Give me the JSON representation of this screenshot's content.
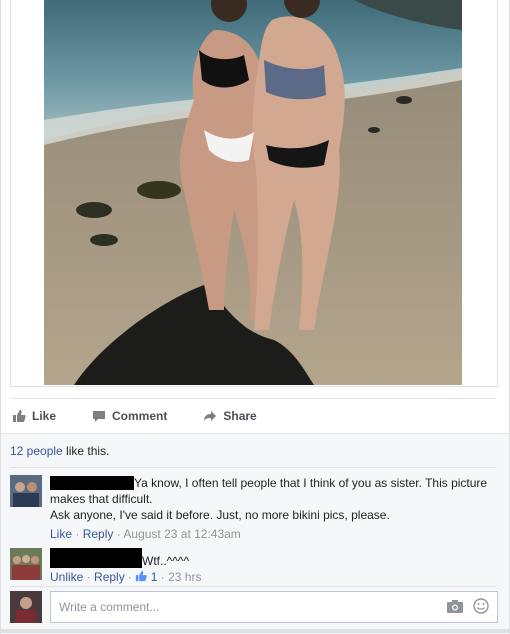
{
  "post": {
    "photo_icon": "beach-photo",
    "actions": {
      "like": "Like",
      "comment": "Comment",
      "share": "Share"
    }
  },
  "likes": {
    "count_text": "12 people",
    "suffix": " like this."
  },
  "comments": [
    {
      "text_line1": "Ya know, I often tell people that I think of you as sister. This picture makes that difficult.",
      "text_line2": "Ask anyone, I've said it before. Just, no more bikini pics, please.",
      "like_label": "Like",
      "reply_label": "Reply",
      "time": "August 23 at 12:43am"
    },
    {
      "text": "Wtf..^^^^",
      "unlike_label": "Unlike",
      "reply_label": "Reply",
      "like_count": "1",
      "time": "23 hrs"
    }
  ],
  "composer": {
    "placeholder": "Write a comment..."
  },
  "colors": {
    "link": "#365899",
    "meta": "#90949c",
    "border": "#dddfe2"
  }
}
